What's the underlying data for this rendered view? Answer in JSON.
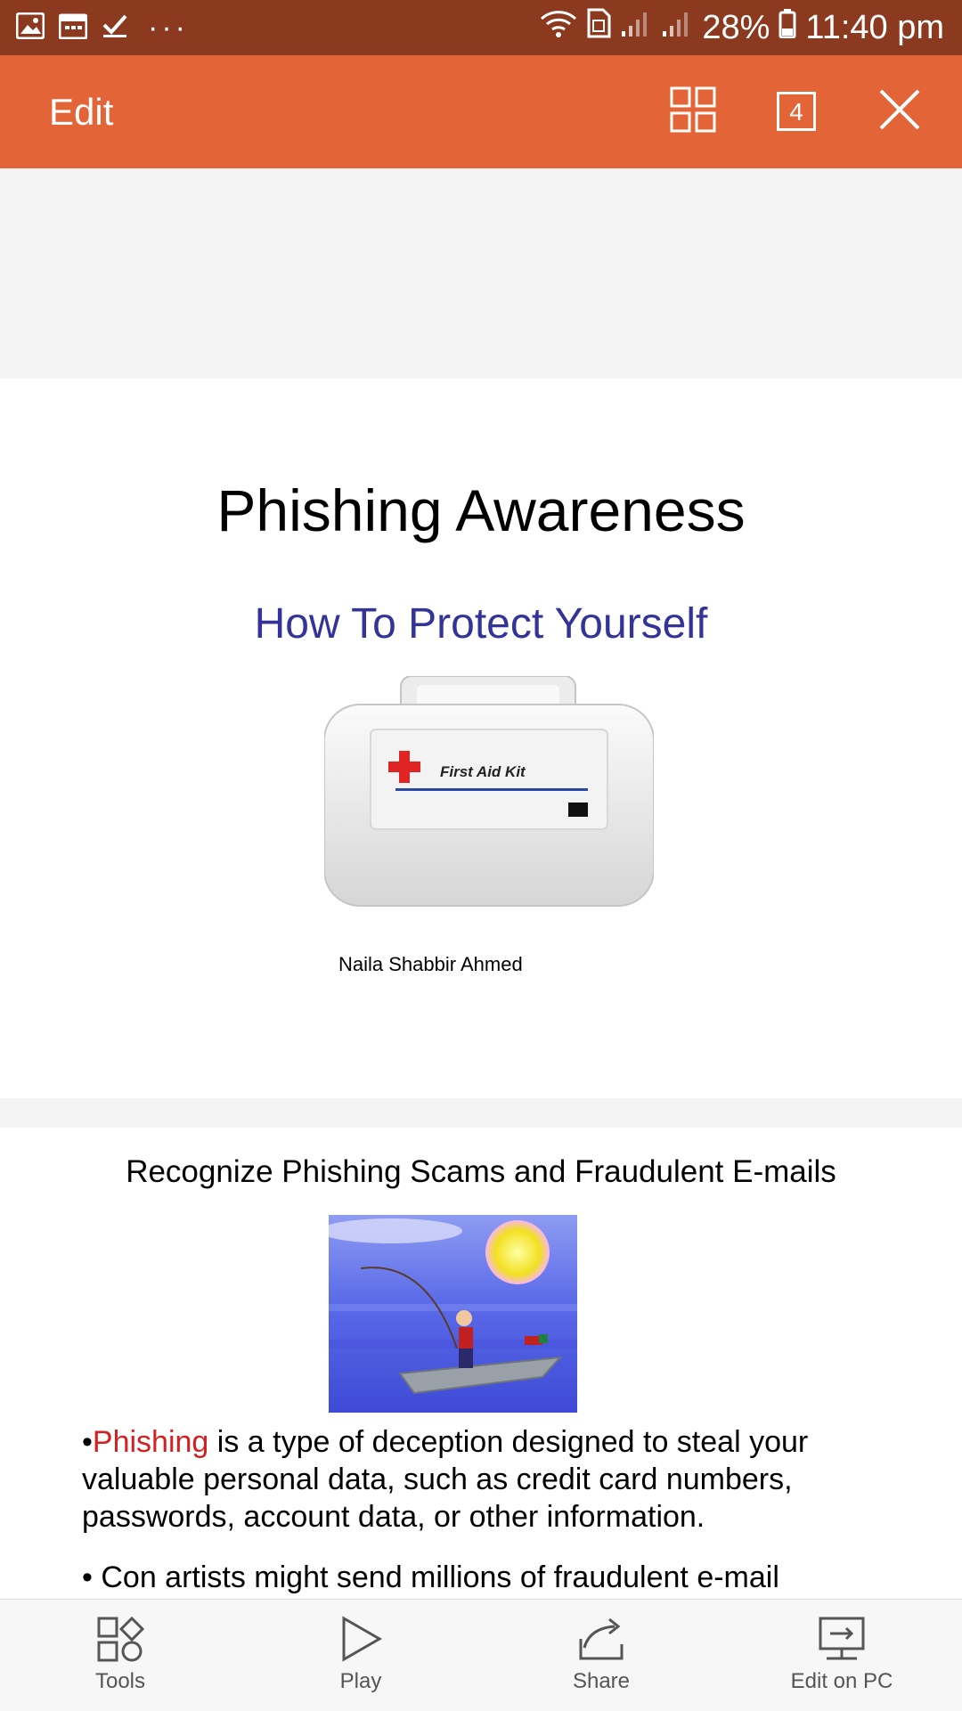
{
  "status_bar": {
    "battery": "28%",
    "time": "11:40 pm",
    "overflow": "···"
  },
  "app_bar": {
    "title": "Edit",
    "slide_count": "4"
  },
  "slide1": {
    "title": "Phishing Awareness",
    "subtitle": "How To Protect Yourself",
    "image_label": "First Aid Kit",
    "author": "Naila Shabbir Ahmed"
  },
  "slide2": {
    "title": "Recognize Phishing Scams and Fraudulent E-mails",
    "bullet1_bullet": "•",
    "bullet1_keyword": "Phishing",
    "bullet1_text": " is a type of deception designed to steal your valuable personal data, such as credit card numbers, passwords, account data, or other information.",
    "bullet2_text": "• Con artists might send millions of fraudulent e-mail"
  },
  "bottom_bar": {
    "tools": "Tools",
    "play": "Play",
    "share": "Share",
    "edit_on_pc": "Edit on PC"
  },
  "colors": {
    "status_bar": "#8b3a1f",
    "app_bar": "#e36436",
    "subtitle": "#333399",
    "keyword": "#d32020"
  }
}
